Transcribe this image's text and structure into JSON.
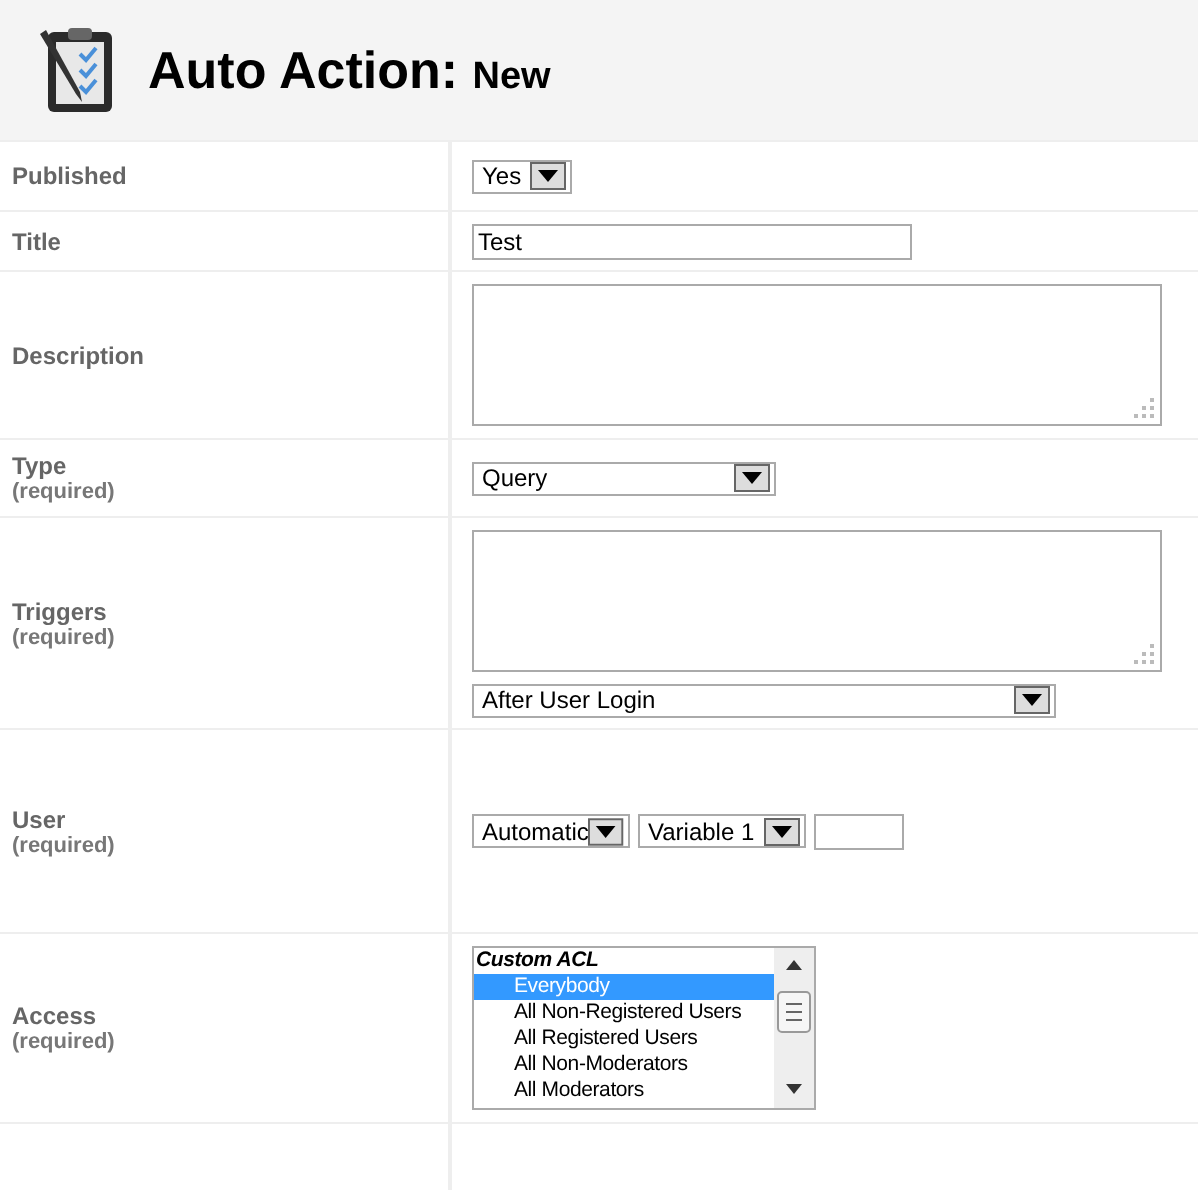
{
  "header": {
    "title": "Auto Action:",
    "subtitle": "New"
  },
  "rows": [
    {
      "label": "Published",
      "required_note": null,
      "controls": [
        {
          "kind": "select",
          "value": "Yes"
        }
      ]
    },
    {
      "label": "Title",
      "required_note": null,
      "controls": [
        {
          "kind": "text",
          "value": "Test"
        }
      ]
    },
    {
      "label": "Description",
      "required_note": null,
      "controls": [
        {
          "kind": "textarea"
        }
      ]
    },
    {
      "label": "Type",
      "required_note": "(required)",
      "controls": [
        {
          "kind": "select",
          "value": "Query"
        }
      ]
    },
    {
      "label": "Triggers",
      "required_note": "(required)",
      "controls": [
        {
          "kind": "textarea"
        },
        {
          "kind": "select",
          "value": "After User Login"
        }
      ]
    },
    {
      "label": "User",
      "required_note": "(required)",
      "controls": [
        {
          "kind": "select",
          "value": "Automatic"
        },
        {
          "kind": "select",
          "value": "Variable 1"
        },
        {
          "kind": "text"
        }
      ]
    },
    {
      "label": "Access",
      "required_note": "(required)",
      "controls": [
        {
          "kind": "listbox",
          "group": "Custom ACL",
          "options": [
            {
              "label": "Everybody",
              "selected": true
            },
            {
              "label": "All Non-Registered Users",
              "selected": false
            },
            {
              "label": "All Registered Users",
              "selected": false
            },
            {
              "label": "All Non-Moderators",
              "selected": false
            },
            {
              "label": "All Moderators",
              "selected": false
            }
          ]
        }
      ]
    }
  ]
}
